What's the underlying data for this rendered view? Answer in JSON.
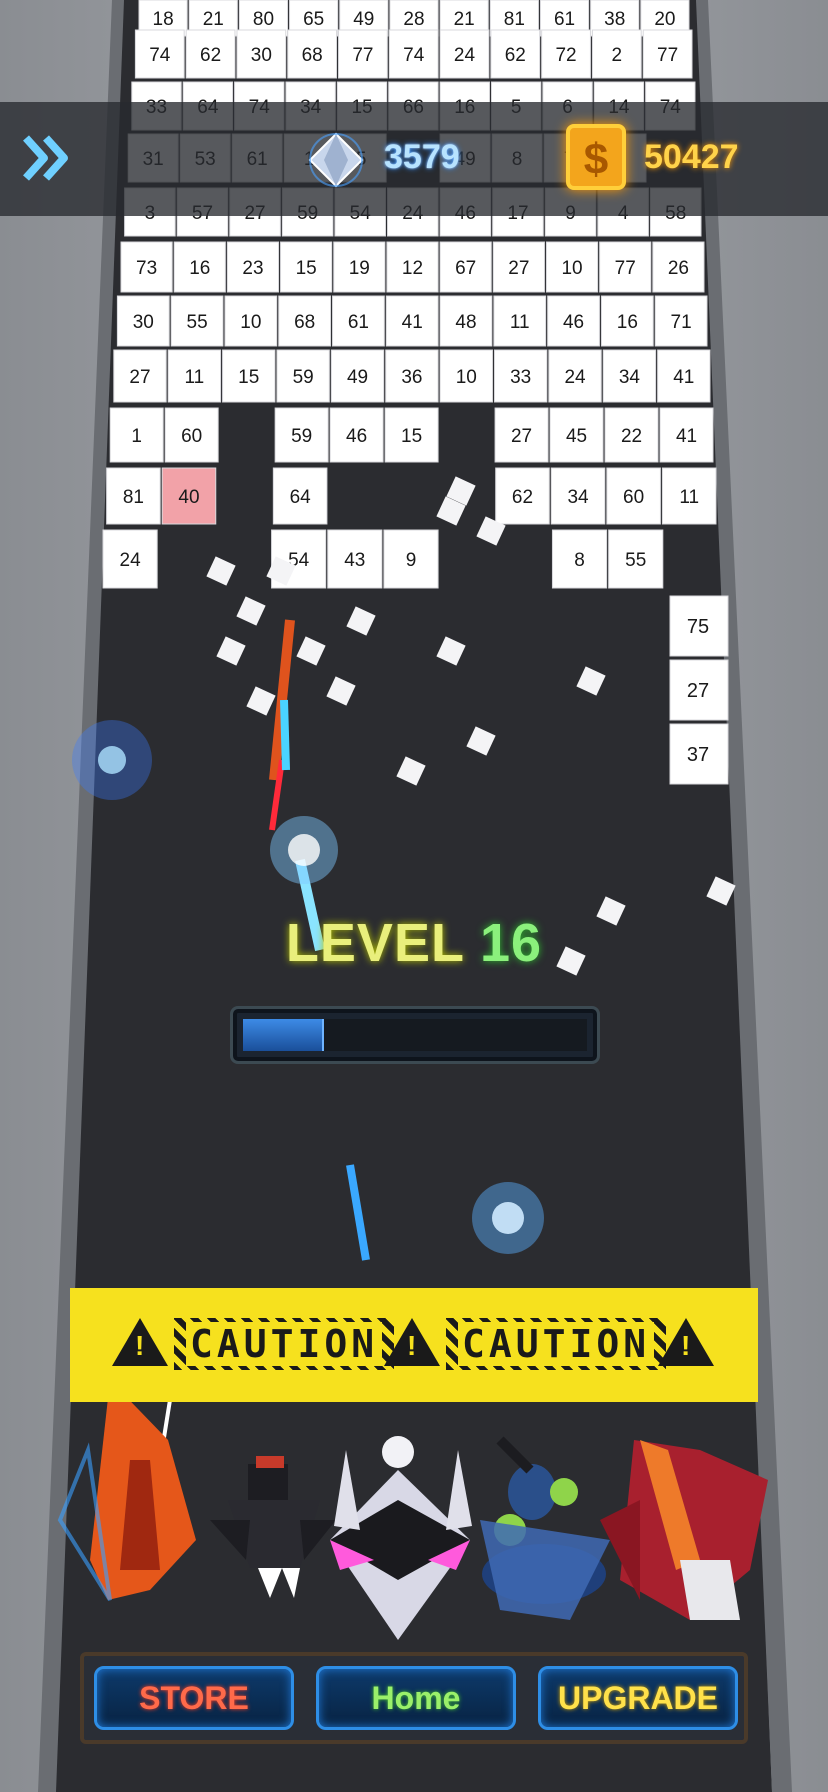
{
  "hud": {
    "skip_icon": "double-chevron-right-icon",
    "gem_icon": "diamond-icon",
    "gem_count": "3579",
    "coin_icon": "dollar-coin-icon",
    "coin_symbol": "$",
    "coin_count": "50427"
  },
  "level": {
    "word": "LEVEL",
    "number": "16",
    "progress": 0.23
  },
  "caution": {
    "text": "CAUTION",
    "icon": "warning-triangle-icon"
  },
  "nav": {
    "store": "STORE",
    "home": "Home",
    "upgrade": "UPGRADE"
  },
  "ships": [
    "orange-fighter-icon",
    "black-fighter-icon",
    "white-star-ship-icon",
    "blue-green-ship-icon",
    "red-winged-ship-icon"
  ],
  "grid": {
    "rows": [
      [
        "18",
        "21",
        "80",
        "65",
        "49",
        "28",
        "21",
        "81",
        "61",
        "38",
        "20"
      ],
      [
        "74",
        "62",
        "30",
        "68",
        "77",
        "74",
        "24",
        "62",
        "72",
        "2",
        "77"
      ],
      [
        "33",
        "64",
        "74",
        "34",
        "15",
        "66",
        "16",
        "5",
        "6",
        "14",
        "74"
      ],
      [
        "31",
        "53",
        "61",
        "1",
        "5",
        "",
        "49",
        "8",
        "7",
        "7",
        ""
      ],
      [
        "3",
        "57",
        "27",
        "59",
        "54",
        "24",
        "46",
        "17",
        "9",
        "4",
        "58"
      ],
      [
        "73",
        "16",
        "23",
        "15",
        "19",
        "12",
        "67",
        "27",
        "10",
        "77",
        "26"
      ],
      [
        "30",
        "55",
        "10",
        "68",
        "61",
        "41",
        "48",
        "11",
        "46",
        "16",
        "71"
      ],
      [
        "27",
        "11",
        "15",
        "59",
        "49",
        "36",
        "10",
        "33",
        "24",
        "34",
        "41"
      ],
      [
        "1",
        "60",
        "",
        "59",
        "46",
        "15",
        "",
        "27",
        "45",
        "22",
        "41"
      ],
      [
        "81",
        "40",
        "",
        "64",
        "",
        "",
        "",
        "62",
        "34",
        "60",
        "11"
      ],
      [
        "24",
        "",
        "",
        "54",
        "43",
        "9",
        "",
        "",
        "8",
        "55",
        ""
      ]
    ],
    "side_column": [
      "75",
      "27",
      "37"
    ],
    "highlight_value": "40"
  },
  "colors": {
    "lane": "#2b2c30",
    "block": "#ffffff",
    "block_highlight": "#f2a2a8",
    "caution_yellow": "#f6e11e",
    "gem_glow": "#2a8cff",
    "coin_gold": "#ffd34a"
  }
}
